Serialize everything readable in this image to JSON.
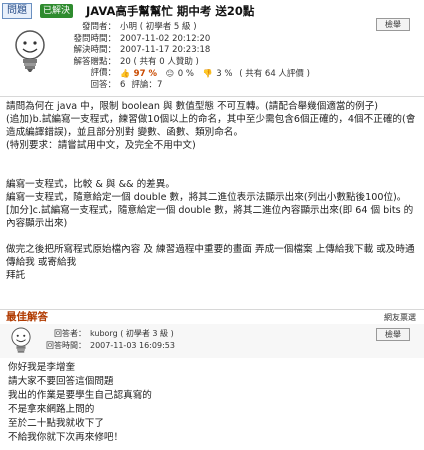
{
  "question": {
    "badge": "問題",
    "solved_tag": "已解決",
    "title": "JAVA高手幫幫忙 期中考 送20點",
    "meta": [
      {
        "key": "發問者：",
        "value": "小明 ( 初學者 5 級 )"
      },
      {
        "key": "發問時間：",
        "value": "2007-11-02 20:12:20"
      },
      {
        "key": "解決時間：",
        "value": "2007-11-17 20:23:18"
      },
      {
        "key": "解答贈點：",
        "value": "20 ( 共有 0 人贊助 )"
      }
    ],
    "rating": {
      "key": "評價：",
      "good": "97 %",
      "neutral": "0 %",
      "bad": "3 %",
      "total": "( 共有 64 人評價 )"
    },
    "answers": {
      "key": "回答：",
      "value": "6",
      "comments_key": "評論：",
      "comments": "7"
    },
    "report_label": "檢舉",
    "body": [
      "請問為何在 java 中，限制 boolean 與 數值型態 不可互轉。(請配合舉幾個適當的例子)",
      "(追加)b.試編寫一支程式，練習做10個以上的命名，其中至少需包含6個正確的，4個不正確的(會造成編譯錯誤)，並且部分別對 變數、函數、類別命名。",
      "(特別要求：請嘗試用中文，及完全不用中文)",
      "",
      "",
      "編寫一支程式，比較 & 與 && 的差異。",
      "編寫一支程式，隨意給定一個 double 數，將其二進位表示法顯示出來(列出小數點後100位)。",
      "[加分]c.試編寫一支程式，隨意給定一個 double 數，將其二進位內容顯示出來(即 64 個 bits 的內容顯示出來)",
      "",
      "做完之後把所寫程式原始檔內容 及 練習過程中重要的畫面 弄成一個檔案 上傳給我下載 或及時通傳給我 或寄給我",
      "拜託"
    ]
  },
  "best_answer": {
    "title": "最佳解答",
    "link": "網友票選",
    "meta": [
      {
        "key": "回答者：",
        "value": "kuborg ( 初學者 3 級 )"
      },
      {
        "key": "回答時間：",
        "value": "2007-11-03 16:09:53"
      }
    ],
    "report_label": "檢舉",
    "body": [
      "你好我是李增奎",
      "請大家不要回答這個問題",
      "我出的作業是要學生自己認真寫的",
      "不是拿來網路上問的",
      "至於二十點我就收下了",
      "不給我你就下次再來修吧！"
    ]
  },
  "colors": {
    "accent": "#b03a00",
    "badge_border": "#6a8fc0",
    "solved": "#2e8b2e"
  }
}
